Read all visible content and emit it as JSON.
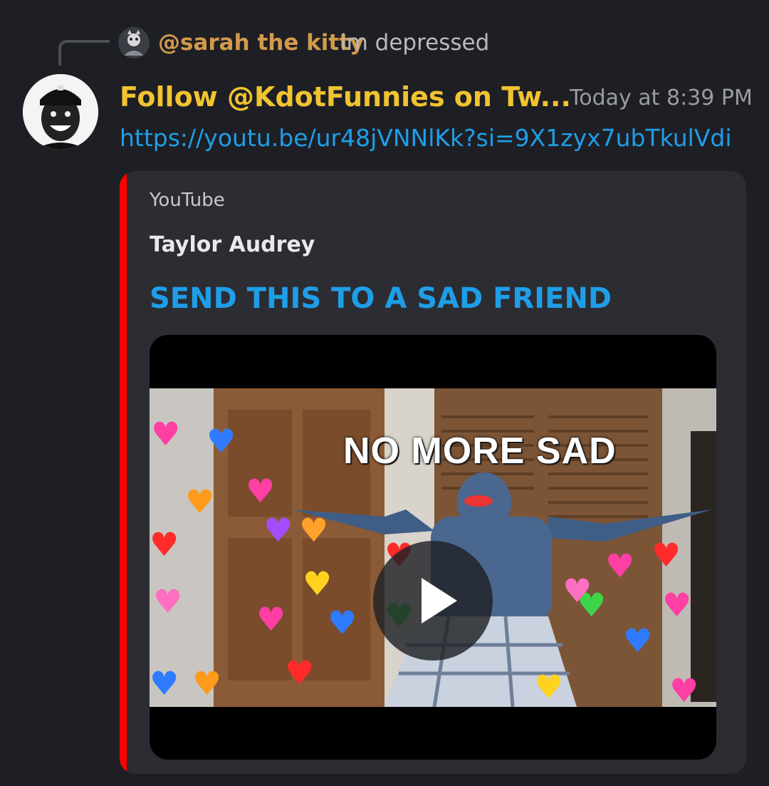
{
  "reply": {
    "username": "@sarah the kitty",
    "message": "im depressed"
  },
  "message": {
    "username": "Follow @KdotFunnies on Tw...",
    "timestamp": "Today at 8:39 PM",
    "link": "https://youtu.be/ur48jVNNlKk?si=9X1zyx7ubTkulVdi"
  },
  "embed": {
    "provider": "YouTube",
    "author": "Taylor Audrey",
    "title": "SEND THIS TO A SAD FRIEND",
    "accent_color": "#ff0000",
    "thumbnail_text": "NO MORE SAD",
    "play_icon": "play-icon"
  },
  "colors": {
    "username": "#f0c330",
    "reply_username": "#d29a4a",
    "link": "#1f9ee8",
    "background": "#1e1f24",
    "embed_bg": "#2b2d33"
  }
}
